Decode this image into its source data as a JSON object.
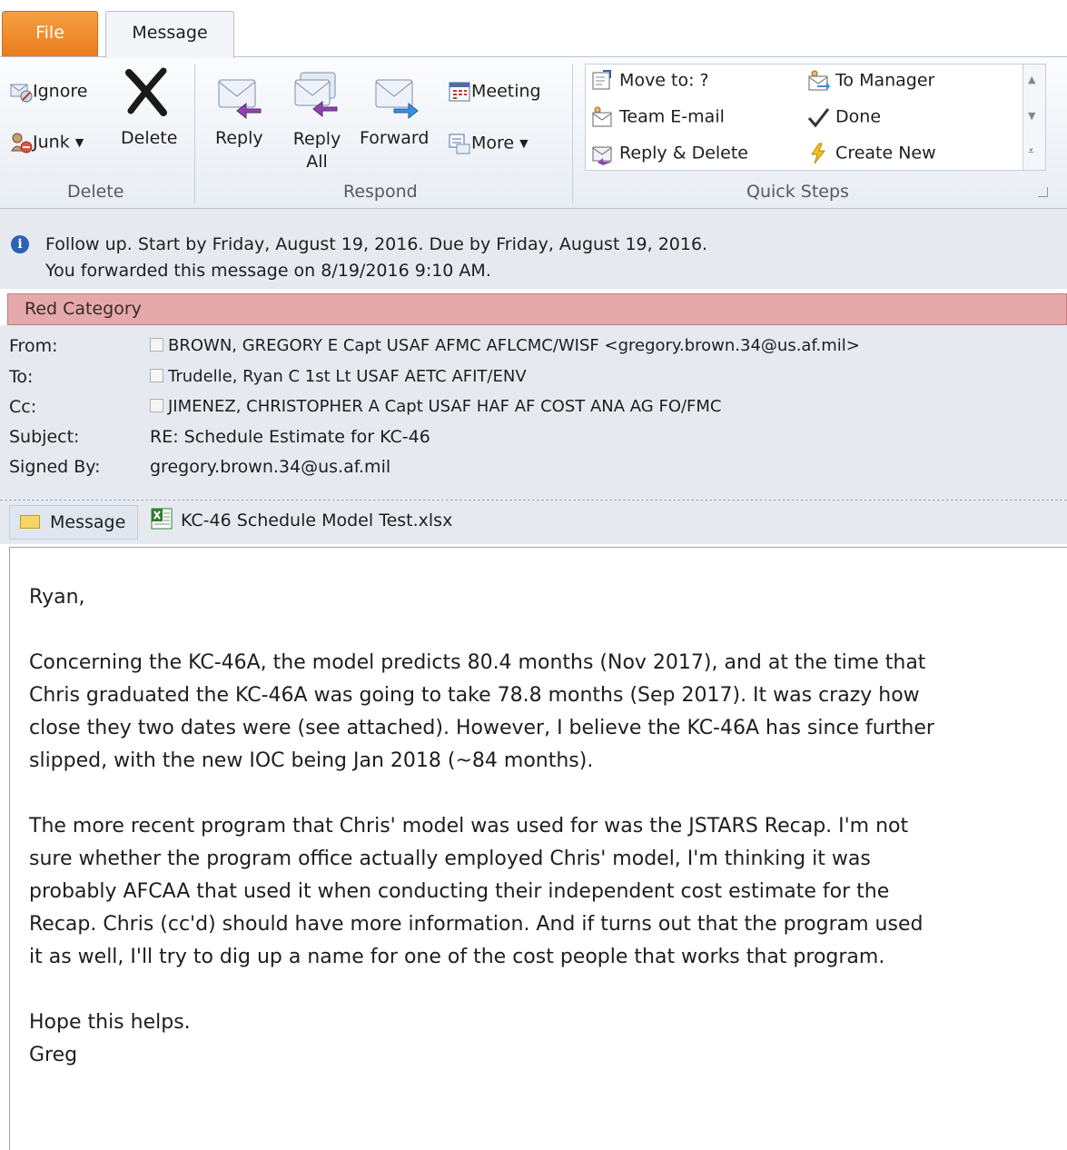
{
  "tabs": {
    "file": "File",
    "message": "Message"
  },
  "ribbon": {
    "delete_group": {
      "label": "Delete",
      "ignore": "Ignore",
      "junk": "Junk ▾",
      "delete": "Delete"
    },
    "respond_group": {
      "label": "Respond",
      "reply": "Reply",
      "reply_all_1": "Reply",
      "reply_all_2": "All",
      "forward": "Forward",
      "meeting": "Meeting",
      "more": "More ▾"
    },
    "quick_steps": {
      "label": "Quick Steps",
      "items": [
        "Move to: ?",
        "Team E-mail",
        "Reply & Delete",
        "To Manager",
        "Done",
        "Create New"
      ]
    }
  },
  "info": {
    "line1": "Follow up.  Start by Friday, August 19, 2016.  Due by Friday, August 19, 2016.",
    "line2": "You forwarded this message on 8/19/2016 9:10 AM."
  },
  "category": "Red Category",
  "headers": {
    "from_label": "From:",
    "from": "BROWN, GREGORY E Capt USAF AFMC AFLCMC/WISF <gregory.brown.34@us.af.mil>",
    "to_label": "To:",
    "to": "Trudelle, Ryan C 1st Lt USAF AETC AFIT/ENV",
    "cc_label": "Cc:",
    "cc": "JIMENEZ, CHRISTOPHER A Capt USAF HAF AF COST ANA AG FO/FMC",
    "subject_label": "Subject:",
    "subject": "RE: Schedule Estimate for KC-46",
    "signed_label": "Signed By:",
    "signed": "gregory.brown.34@us.af.mil"
  },
  "attachments": {
    "message_tab": "Message",
    "file": "KC-46 Schedule Model Test.xlsx"
  },
  "body": {
    "greeting": "Ryan,",
    "p1": "Concerning the KC-46A, the model predicts 80.4 months (Nov 2017), and at the time that Chris graduated the KC-46A was going to take 78.8 months (Sep 2017).  It was crazy how close they two dates were (see attached).  However, I believe the KC-46A has since further slipped, with the new IOC being Jan 2018 (~84 months).",
    "p2": "The more recent program that Chris' model was used for was the JSTARS Recap. I'm not sure whether the program office actually employed Chris' model, I'm thinking it was probably AFCAA that used it when conducting their independent cost estimate for the Recap.  Chris (cc'd) should have more information.  And if turns out that the program used it as well, I'll try to dig up a name for one of the cost people that works that program.",
    "closing1": "Hope this helps.",
    "closing2": "Greg"
  }
}
